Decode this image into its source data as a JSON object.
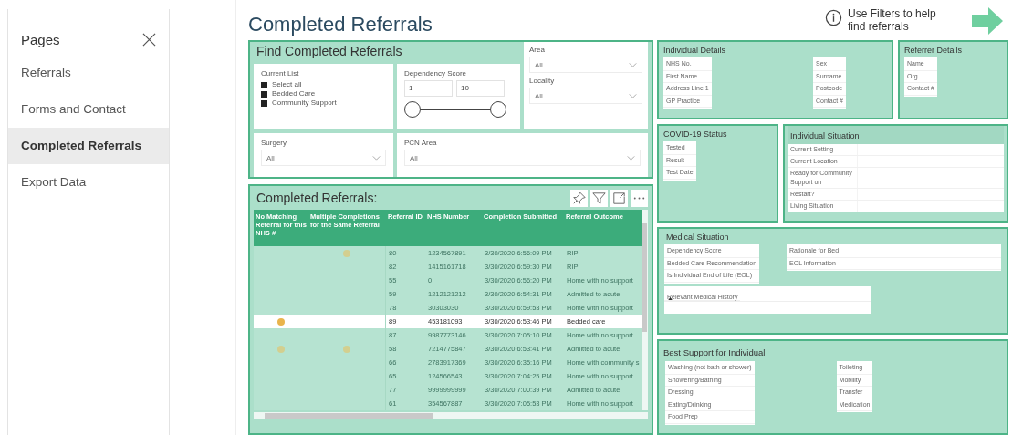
{
  "sidebar": {
    "title": "Pages",
    "items": [
      {
        "label": "Referrals",
        "selected": false
      },
      {
        "label": "Forms and Contact",
        "selected": false
      },
      {
        "label": "Completed Referrals",
        "selected": true
      },
      {
        "label": "Export Data",
        "selected": false
      }
    ]
  },
  "page_title": "Completed Referrals",
  "hint": "Use Filters to help find referrals",
  "filters": {
    "title": "Find Completed Referrals",
    "current_list": {
      "label": "Current List",
      "options": [
        {
          "label": "Select all",
          "checked": true
        },
        {
          "label": "Bedded Care",
          "checked": true
        },
        {
          "label": "Community Support",
          "checked": true
        }
      ]
    },
    "dependency_score": {
      "label": "Dependency Score",
      "min": "1",
      "max": "10",
      "thumbs": [
        {
          "level": 0
        },
        {
          "level": 1
        }
      ]
    },
    "area": {
      "label": "Area",
      "value": "All"
    },
    "locality": {
      "label": "Locality",
      "value": "All"
    },
    "surgery": {
      "label": "Surgery",
      "value": "All"
    },
    "pcn_area": {
      "label": "PCN Area",
      "value": "All"
    }
  },
  "table": {
    "title": "Completed Referrals:",
    "columns": [
      "No Matching Referral for this NHS #",
      "Multiple Completions for the Same Referral",
      "Referral ID",
      "NHS Number",
      "Completion Submitted",
      "Referral Outcome"
    ],
    "rows": [
      {
        "selected": false,
        "no_match": false,
        "multiple": true,
        "cells": [
          "",
          "",
          "80",
          "1234567891",
          "3/30/2020 6:56:09 PM",
          "RIP"
        ]
      },
      {
        "selected": false,
        "no_match": false,
        "multiple": false,
        "cells": [
          "",
          "",
          "82",
          "1415161718",
          "3/30/2020 6:59:30 PM",
          "RIP"
        ]
      },
      {
        "selected": false,
        "no_match": false,
        "multiple": false,
        "cells": [
          "",
          "",
          "55",
          "0",
          "3/30/2020 6:56:20 PM",
          "Home with no support"
        ]
      },
      {
        "selected": false,
        "no_match": false,
        "multiple": false,
        "cells": [
          "",
          "",
          "59",
          "1212121212",
          "3/30/2020 6:54:31 PM",
          "Admitted to acute"
        ]
      },
      {
        "selected": false,
        "no_match": false,
        "multiple": false,
        "cells": [
          "",
          "",
          "78",
          "30303030",
          "3/30/2020 6:59:53 PM",
          "Home with no support"
        ]
      },
      {
        "selected": true,
        "no_match": true,
        "multiple": false,
        "cells": [
          "",
          "",
          "89",
          "453181093",
          "3/30/2020 6:53:46 PM",
          "Bedded care"
        ]
      },
      {
        "selected": false,
        "no_match": false,
        "multiple": false,
        "cells": [
          "",
          "",
          "87",
          "9987773146",
          "3/30/2020 7:05:10 PM",
          "Home with no support"
        ]
      },
      {
        "selected": false,
        "no_match": true,
        "multiple": true,
        "cells": [
          "",
          "",
          "58",
          "7214775847",
          "3/30/2020 6:53:41 PM",
          "Admitted to acute"
        ]
      },
      {
        "selected": false,
        "no_match": false,
        "multiple": false,
        "cells": [
          "",
          "",
          "66",
          "2783917369",
          "3/30/2020 6:35:16 PM",
          "Home with community s"
        ]
      },
      {
        "selected": false,
        "no_match": false,
        "multiple": false,
        "cells": [
          "",
          "",
          "65",
          "124566543",
          "3/30/2020 7:04:25 PM",
          "Home with no support"
        ]
      },
      {
        "selected": false,
        "no_match": false,
        "multiple": false,
        "cells": [
          "",
          "",
          "77",
          "9999999999",
          "3/30/2020 7:00:39 PM",
          "Admitted to acute"
        ]
      },
      {
        "selected": false,
        "no_match": false,
        "multiple": false,
        "cells": [
          "",
          "",
          "61",
          "354567887",
          "3/30/2020 7:05:53 PM",
          "Home with no support"
        ]
      }
    ]
  },
  "individual_details": {
    "title": "Individual Details",
    "groups": [
      {
        "fields": [
          "NHS No.",
          "First Name",
          "Address Line 1",
          "GP Practice"
        ]
      },
      {
        "fields": [
          "Sex",
          "Surname",
          "Postcode",
          "Contact #"
        ]
      }
    ]
  },
  "referrer_details": {
    "title": "Referrer Details",
    "fields": [
      "Name",
      "Org",
      "Contact #"
    ]
  },
  "covid_status": {
    "title": "COVID-19 Status",
    "fields": [
      "Tested",
      "Result",
      "Test Date"
    ]
  },
  "individual_situation": {
    "title": "Individual Situation",
    "fields": [
      "Current Setting",
      "Current Location",
      "Ready for Community Support on",
      "Restart?",
      "Living Situation"
    ]
  },
  "medical_situation": {
    "title": "Medical Situation",
    "groups": [
      {
        "fields": [
          "Dependency Score",
          "Bedded Care Recommendation",
          "Is Individual End of Life (EOL)"
        ]
      },
      {
        "fields": [
          "Rationale for Bed",
          "EOL Information"
        ]
      }
    ],
    "history": "Relevant Medical History"
  },
  "best_support": {
    "title": "Best Support for Individual",
    "groups": [
      {
        "fields": [
          "Washing (not bath or shower)",
          "Showering/Bathing",
          "Dressing",
          "Eating/Drinking",
          "Food Prep"
        ]
      },
      {
        "fields": [
          "Toileting",
          "Mobility",
          "Transfer",
          "Medication"
        ]
      }
    ]
  }
}
